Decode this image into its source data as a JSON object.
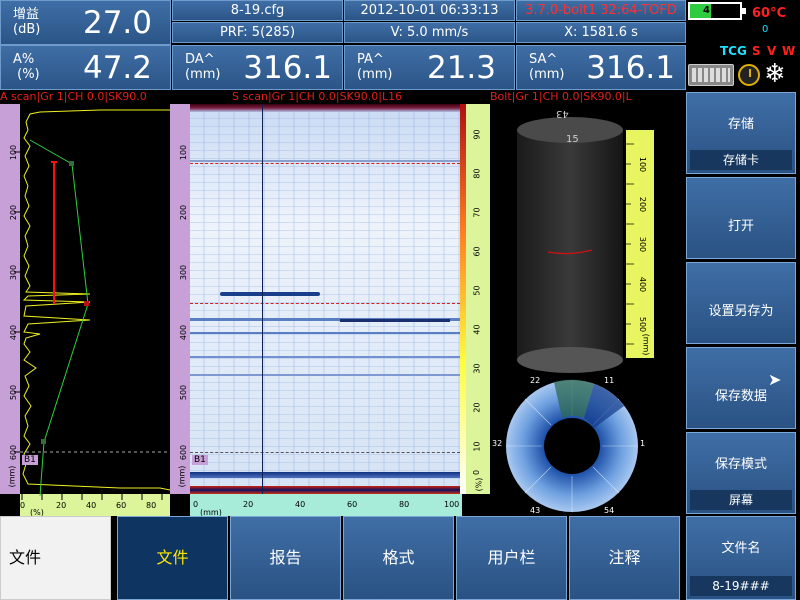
{
  "readouts": {
    "gain": {
      "label": "增益\n(dB)",
      "value": "27.0"
    },
    "a_pct": {
      "label": "A%\n (%)",
      "value": "47.2"
    },
    "da": {
      "label": "DA^\n(mm)",
      "value": "316.1"
    },
    "pa": {
      "label": "PA^\n(mm)",
      "value": "21.3"
    },
    "sa": {
      "label": "SA^\n(mm)",
      "value": "316.1"
    }
  },
  "info": {
    "file": "8-19.cfg",
    "datetime": "2012-10-01 06:33:13",
    "model": "3.7.0-bolt1  32:64-TOFD",
    "prf": "PRF: 5(285)",
    "velocity": "V: 5.0 mm/s",
    "x_pos": "X: 1581.6  s"
  },
  "status": {
    "battery": "41%",
    "battery_level": 0.41,
    "temperature": "60°C",
    "tcg": "TCG",
    "s": "S",
    "v": "V",
    "w": "W",
    "zero": "0"
  },
  "titles": {
    "ascan": "A scan|Gr 1|CH 0.0|SK90.0",
    "sscan": "S scan|Gr 1|CH 0.0|SK90.0|L16",
    "bolt": "Bolt|Gr 1|CH 0.0|SK90.0|L"
  },
  "ascan": {
    "v_ticks": [
      "100",
      "200",
      "300",
      "400",
      "500",
      "600"
    ],
    "h_ticks": [
      "0",
      "20",
      "40",
      "60",
      "80"
    ],
    "v_unit": "(mm)",
    "h_unit": "(%)",
    "gate_label": "B1"
  },
  "sscan": {
    "v_ticks": [
      "100",
      "200",
      "300",
      "400",
      "500",
      "600"
    ],
    "h_ticks": [
      "0",
      "20",
      "40",
      "60",
      "80",
      "100"
    ],
    "v_unit": "(mm)",
    "h_unit": "(mm)",
    "gate_label": "B1",
    "amp_ticks": [
      "90",
      "80",
      "70",
      "60",
      "50",
      "40",
      "30",
      "20",
      "10",
      "0"
    ],
    "amp_unit": "(%)"
  },
  "bolt": {
    "top_numbers": [
      "43",
      "15"
    ],
    "ruler_ticks": [
      "100",
      "200",
      "300",
      "400",
      "500"
    ],
    "ruler_unit": "(mm)",
    "polar_labels": [
      "22",
      "11",
      "1",
      "32",
      "43",
      "54"
    ]
  },
  "side_menu": [
    {
      "label": "存储",
      "sub": "存储卡"
    },
    {
      "label": "打开",
      "sub": ""
    },
    {
      "label": "设置另存为",
      "sub": ""
    },
    {
      "label": "保存数据",
      "sub": ""
    },
    {
      "label": "保存模式",
      "sub": "屏幕"
    }
  ],
  "filename": {
    "label": "文件名",
    "value": "8-19###"
  },
  "tabs": [
    "文件",
    "文件",
    "报告",
    "格式",
    "用户栏",
    "注释"
  ],
  "colors": {
    "accent": "#3f6ea6",
    "active_tab": "#0e3562",
    "active_text": "#ffe800",
    "alarm": "#e0201a"
  }
}
